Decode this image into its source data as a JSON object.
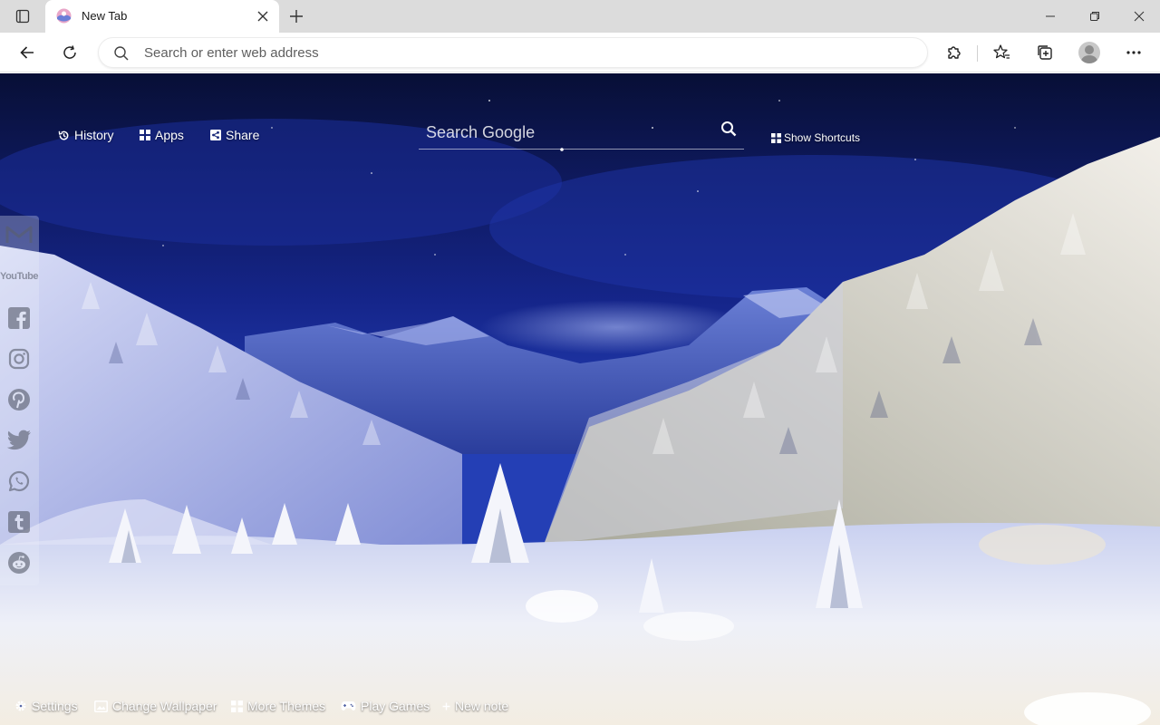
{
  "browser": {
    "tab": {
      "title": "New Tab"
    },
    "omnibox": {
      "placeholder": "Search or enter web address"
    }
  },
  "ntp": {
    "top_links": [
      {
        "label": "History",
        "icon": "history-icon"
      },
      {
        "label": "Apps",
        "icon": "apps-grid-icon"
      },
      {
        "label": "Share",
        "icon": "share-icon"
      }
    ],
    "search": {
      "placeholder": "Search Google",
      "icon": "search-icon"
    },
    "show_shortcuts": {
      "label": "Show Shortcuts",
      "icon": "grid-icon"
    },
    "social": [
      {
        "name": "gmail",
        "icon": "gmail-icon"
      },
      {
        "name": "youtube",
        "icon": "youtube-icon",
        "text": "YouTube"
      },
      {
        "name": "facebook",
        "icon": "facebook-icon"
      },
      {
        "name": "instagram",
        "icon": "instagram-icon"
      },
      {
        "name": "pinterest",
        "icon": "pinterest-icon"
      },
      {
        "name": "twitter",
        "icon": "twitter-icon"
      },
      {
        "name": "whatsapp",
        "icon": "whatsapp-icon"
      },
      {
        "name": "tumblr",
        "icon": "tumblr-icon"
      },
      {
        "name": "reddit",
        "icon": "reddit-icon"
      }
    ],
    "bottom": [
      {
        "label": "Settings",
        "icon": "gear-icon"
      },
      {
        "label": "Change Wallpaper",
        "icon": "wallpaper-icon"
      },
      {
        "label": "More Themes",
        "icon": "themes-icon"
      },
      {
        "label": "Play Games",
        "icon": "gamepad-icon"
      },
      {
        "label": "New note",
        "icon": "plus-icon"
      }
    ]
  },
  "colors": {
    "sky_top": "#0a1240",
    "sky_mid": "#1c2f8a",
    "mountain": "#4a62c4",
    "snow": "#eef0f8"
  }
}
